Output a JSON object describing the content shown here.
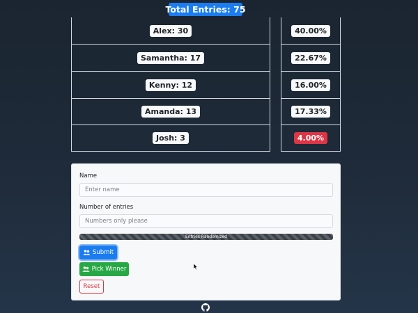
{
  "header": {
    "total_badge": "Total Entries: 75"
  },
  "entries": [
    {
      "label": "Alex: 30",
      "percent": "40.00%",
      "lowest": false
    },
    {
      "label": "Samantha: 17",
      "percent": "22.67%",
      "lowest": false
    },
    {
      "label": "Kenny: 12",
      "percent": "16.00%",
      "lowest": false
    },
    {
      "label": "Amanda: 13",
      "percent": "17.33%",
      "lowest": false
    },
    {
      "label": "Josh: 3",
      "percent": "4.00%",
      "lowest": true
    }
  ],
  "form": {
    "name_label": "Name",
    "name_placeholder": "Enter name",
    "entries_label": "Number of entries",
    "entries_placeholder": "Numbers only please",
    "progress_label": "Entries Randomized",
    "progress_value": 1.0,
    "submit_label": "Submit",
    "pick_winner_label": "Pick Winner",
    "reset_label": "Reset"
  },
  "icons": {
    "submit_icon": "users-icon",
    "pick_winner_icon": "users-icon",
    "footer_icon": "github-icon"
  },
  "colors": {
    "primary": "#1a7cf0",
    "success": "#28a745",
    "danger": "#dc3545"
  }
}
